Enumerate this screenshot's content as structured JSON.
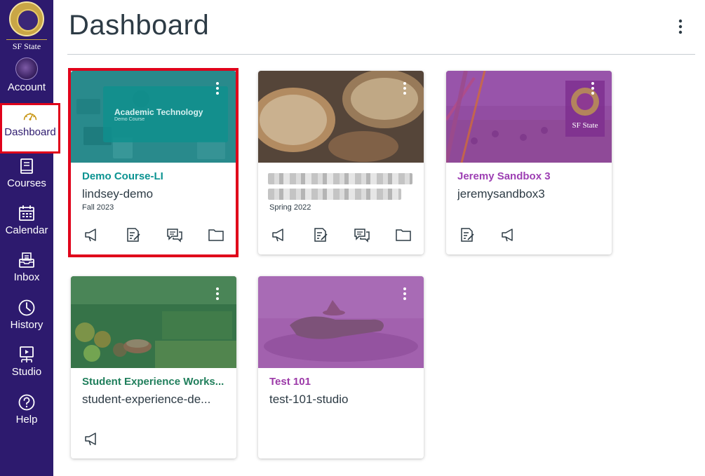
{
  "sidebar": {
    "logo_text": "SF State",
    "items": [
      {
        "label": "Account"
      },
      {
        "label": "Dashboard"
      },
      {
        "label": "Courses"
      },
      {
        "label": "Calendar"
      },
      {
        "label": "Inbox"
      },
      {
        "label": "History"
      },
      {
        "label": "Studio"
      },
      {
        "label": "Help"
      }
    ],
    "bg_color": "#2d1a6e",
    "active_color": "#e0021b"
  },
  "header": {
    "title": "Dashboard"
  },
  "cards": [
    {
      "name": "Demo Course-LI",
      "code": "lindsey-demo",
      "term": "Fall 2023",
      "color": "#0b9391",
      "hero_text_title": "Academic Technology",
      "hero_text_sub": "Demo Course",
      "actions": [
        "announcements-icon",
        "assignments-icon",
        "discussions-icon",
        "files-icon"
      ]
    },
    {
      "name": "",
      "code": "",
      "term": "Spring 2022",
      "color": "#8a6d55",
      "actions": [
        "announcements-icon",
        "assignments-icon",
        "discussions-icon",
        "files-icon"
      ]
    },
    {
      "name": "Jeremy Sandbox 3",
      "code": "jeremysandbox3",
      "term": "",
      "color": "#9d3fb3",
      "hero_logo_text": "SF State",
      "actions": [
        "assignments-icon",
        "announcements-icon"
      ]
    },
    {
      "name": "Student Experience Works...",
      "code": "student-experience-de...",
      "term": "",
      "color": "#207f5c",
      "actions": [
        "announcements-icon"
      ]
    },
    {
      "name": "Test 101",
      "code": "test-101-studio",
      "term": "",
      "color": "#9c3aa8",
      "actions": []
    }
  ]
}
